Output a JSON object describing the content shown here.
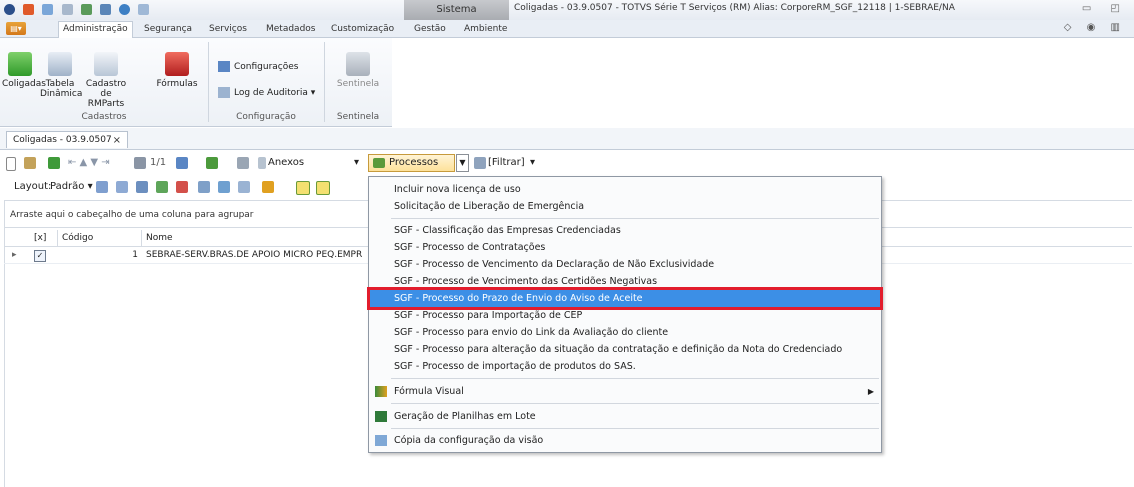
{
  "window": {
    "title": "Coligadas - 03.9.0507 - TOTVS Série T Serviços (RM) Alias: CorporeRM_SGF_12118 | 1-SEBRAE/NA",
    "context_tab": "Sistema"
  },
  "ribbon_tabs": [
    "Administração",
    "Segurança",
    "Serviços",
    "Metadados",
    "Customização",
    "Gestão",
    "Ambiente"
  ],
  "ribbon": {
    "cadastros": {
      "label": "Cadastros",
      "coligadas": "Coligadas",
      "tabela": "Tabela Dinâmica",
      "cadastro": "Cadastro de RMParts",
      "formulas": "Fórmulas"
    },
    "configuracao": {
      "label": "Configuração",
      "configuracoes": "Configurações",
      "log": "Log de Auditoria"
    },
    "sentinela": {
      "label": "Sentinela",
      "button": "Sentinela"
    }
  },
  "doc_tab": {
    "label": "Coligadas - 03.9.0507",
    "close": "×"
  },
  "toolbar": {
    "pager": "1/1",
    "anexos": "Anexos",
    "processos": "Processos",
    "filtrar": "[Filtrar]",
    "layout_label": "Layout:",
    "padrao": "Padrão"
  },
  "grid": {
    "group_hint": "Arraste aqui o cabeçalho de uma coluna para agrupar",
    "headers": [
      "[x]",
      "Código",
      "Nome"
    ],
    "rows": [
      {
        "checked": "✓",
        "codigo": "1",
        "nome": "SEBRAE-SERV.BRAS.DE APOIO MICRO PEQ.EMPR"
      }
    ]
  },
  "menu": {
    "items_top": [
      "Incluir nova licença de uso",
      "Solicitação de Liberação de Emergência"
    ],
    "items_sgf": [
      "SGF - Classificação das Empresas Credenciadas",
      "SGF - Processo de Contratações",
      "SGF - Processo de Vencimento da Declaração de Não Exclusividade",
      "SGF - Processo de Vencimento das Certidões Negativas",
      "SGF - Processo do Prazo de Envio do Aviso de Aceite",
      "SGF - Processo para Importação de CEP",
      "SGF - Processo para envio do Link da Avaliação do cliente",
      "SGF - Processo para alteração da situação da contratação e definição da Nota do Credenciado",
      "SGF - Processo de importação de produtos do SAS."
    ],
    "formula_visual": "Fórmula Visual",
    "geracao": "Geração de Planilhas em Lote",
    "copia": "Cópia da configuração da visão"
  }
}
